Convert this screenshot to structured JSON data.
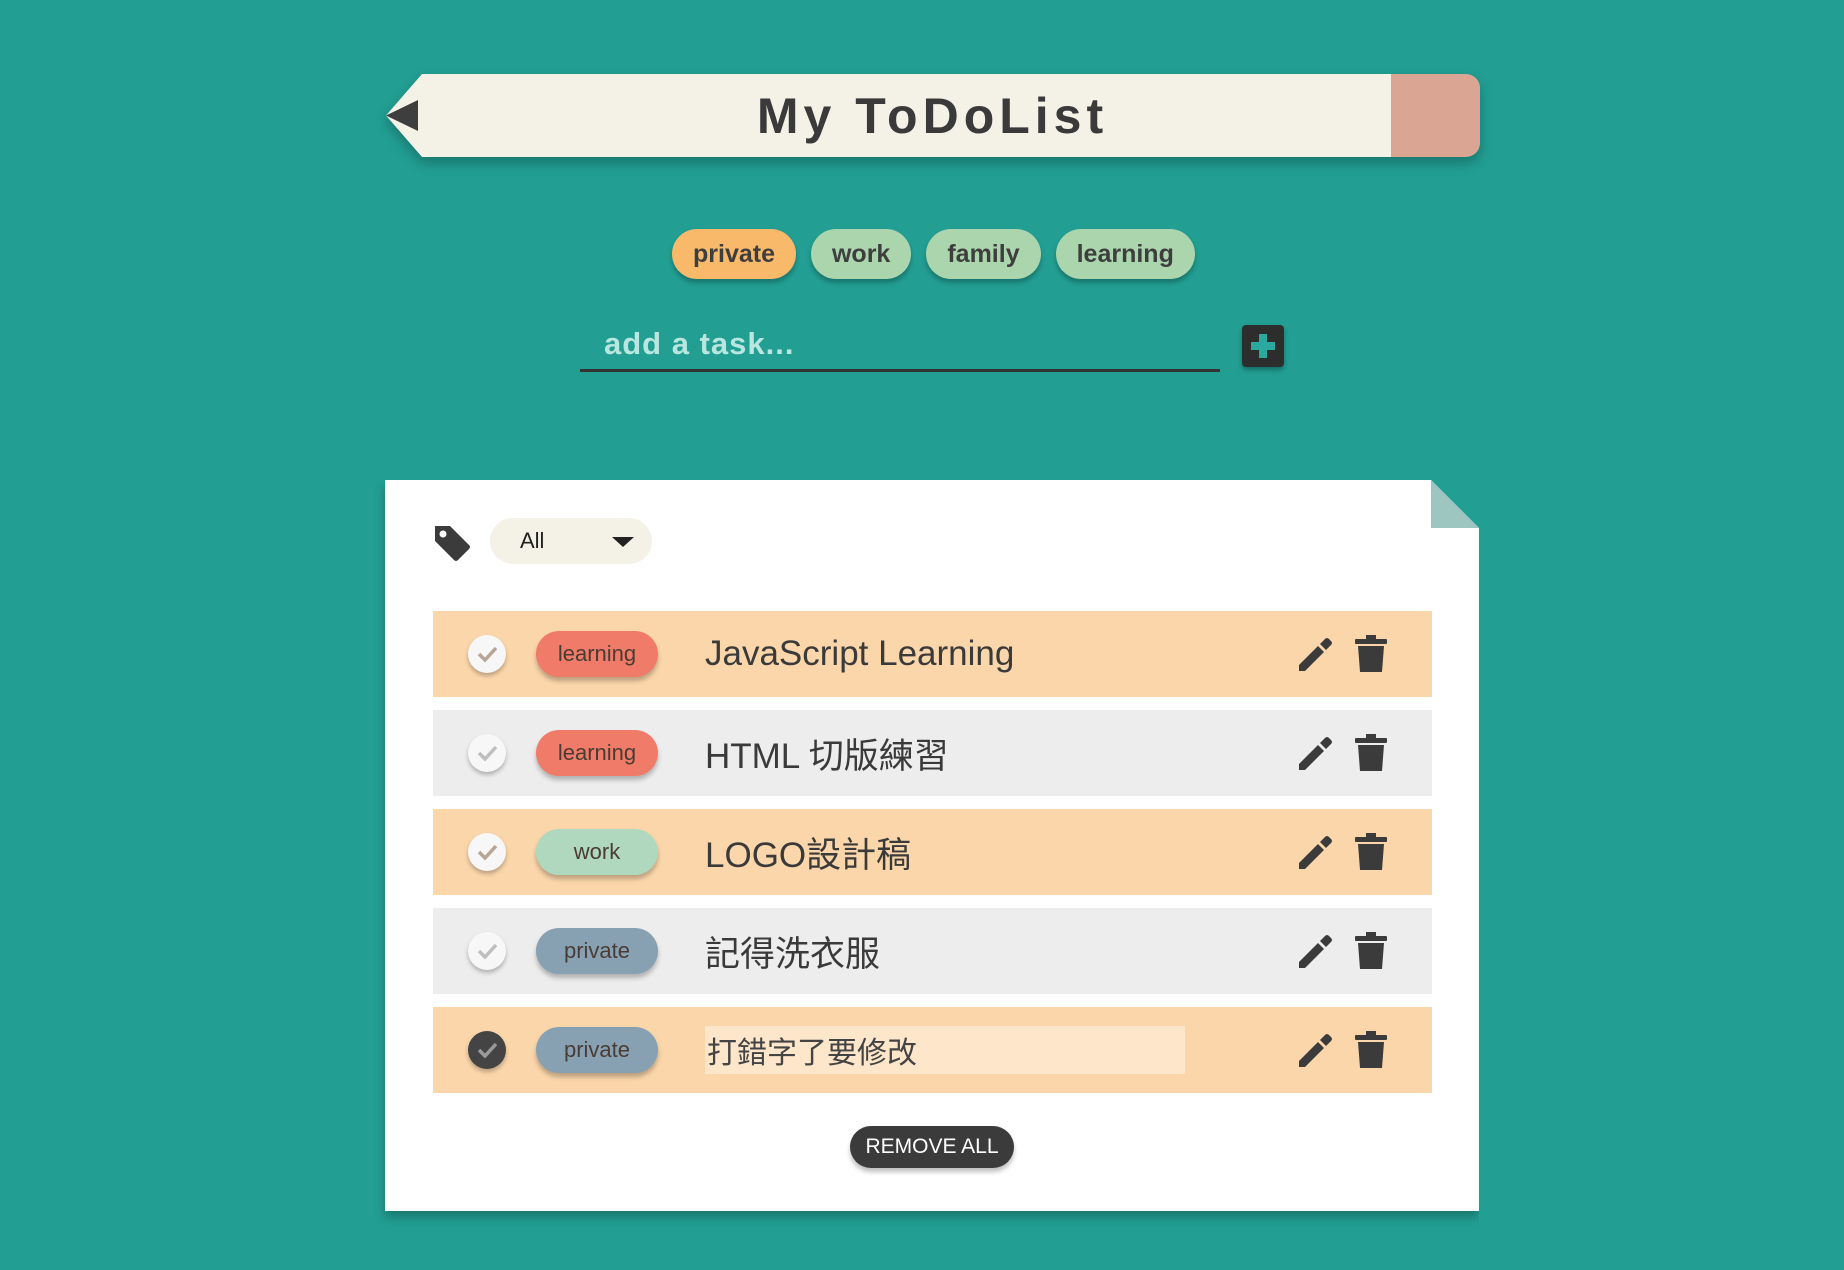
{
  "header": {
    "title": "My ToDoList"
  },
  "categories": [
    {
      "label": "private",
      "active": true
    },
    {
      "label": "work",
      "active": false
    },
    {
      "label": "family",
      "active": false
    },
    {
      "label": "learning",
      "active": false
    }
  ],
  "add_task": {
    "placeholder": "add a task...",
    "button_icon": "plus-icon"
  },
  "filter": {
    "icon": "tag-icon",
    "selected": "All"
  },
  "tasks": [
    {
      "tag": "learning",
      "text": "JavaScript Learning",
      "done": false,
      "editing": false,
      "row_color": "#fbd6aa"
    },
    {
      "tag": "learning",
      "text": "HTML 切版練習",
      "done": false,
      "editing": false,
      "row_color": "#ededed"
    },
    {
      "tag": "work",
      "text": "LOGO設計稿",
      "done": false,
      "editing": false,
      "row_color": "#fbd6aa"
    },
    {
      "tag": "private",
      "text": "記得洗衣服",
      "done": false,
      "editing": false,
      "row_color": "#ededed"
    },
    {
      "tag": "private",
      "text": "打錯字了要修改",
      "done": true,
      "editing": true,
      "row_color": "#fbd6aa"
    }
  ],
  "remove_all_label": "REMOVE ALL",
  "colors": {
    "background": "#229e93",
    "tag_learning": "#ef7b68",
    "tag_work": "#b0d8bf",
    "tag_private": "#87a1b3",
    "chip_active": "#f9b96a",
    "chip_inactive": "#abd6ad"
  }
}
